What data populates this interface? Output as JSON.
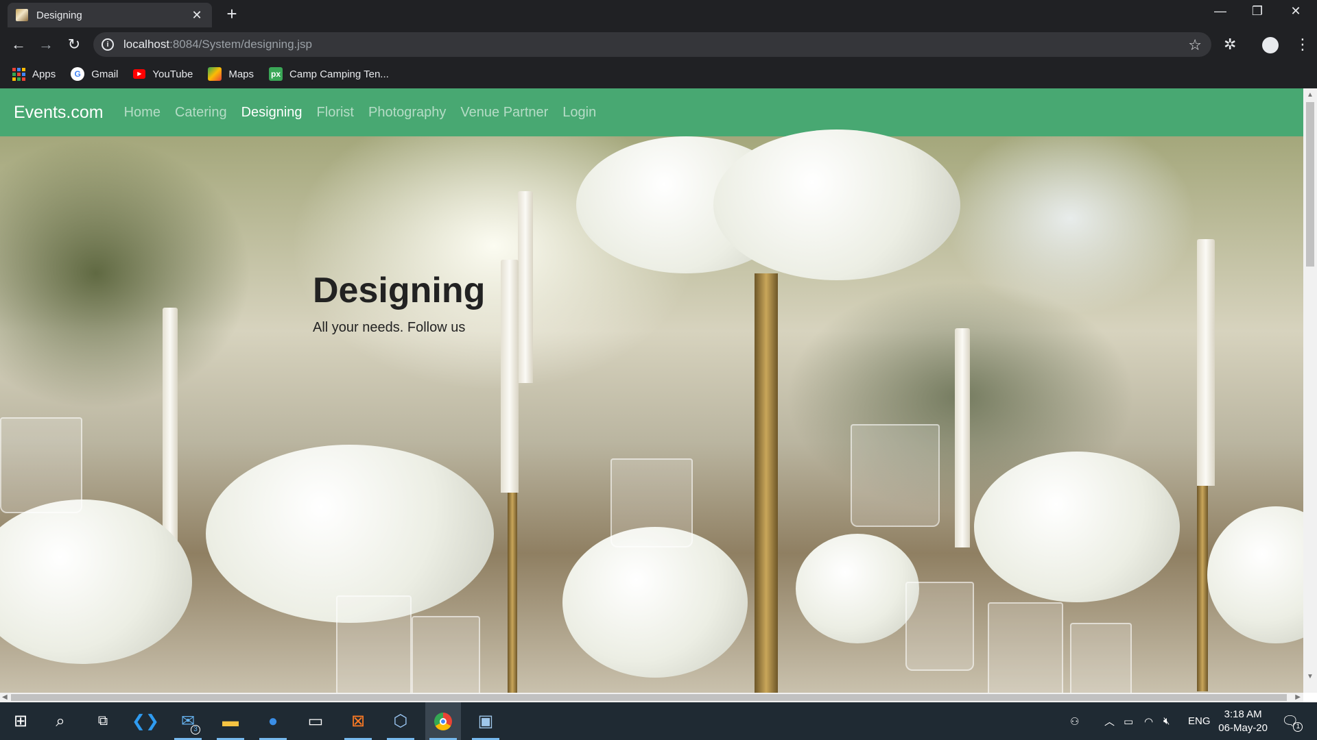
{
  "browser": {
    "tab": {
      "title": "Designing",
      "close_label": "✕"
    },
    "new_tab_label": "+",
    "window_controls": {
      "minimize": "—",
      "restore": "❐",
      "close": "✕"
    },
    "nav": {
      "back": "←",
      "forward": "→",
      "reload": "↻"
    },
    "url": {
      "host": "localhost",
      "path": ":8084/System/designing.jsp"
    },
    "bookmarks": [
      {
        "label": "Apps",
        "icon": "apps-grid-icon"
      },
      {
        "label": "Gmail",
        "icon": "google-icon"
      },
      {
        "label": "YouTube",
        "icon": "youtube-icon"
      },
      {
        "label": "Maps",
        "icon": "maps-icon"
      },
      {
        "label": "Camp Camping Ten...",
        "icon": "px-icon"
      }
    ]
  },
  "site": {
    "brand": "Events.com",
    "nav": [
      {
        "label": "Home",
        "active": false
      },
      {
        "label": "Catering",
        "active": false
      },
      {
        "label": "Designing",
        "active": true
      },
      {
        "label": "Florist",
        "active": false
      },
      {
        "label": "Photography",
        "active": false
      },
      {
        "label": "Venue Partner",
        "active": false
      },
      {
        "label": "Login",
        "active": false
      }
    ],
    "hero": {
      "title": "Designing",
      "subtitle": "All your needs. Follow us"
    },
    "colors": {
      "navbar": "#48a872"
    }
  },
  "taskbar": {
    "mail_badge": "3",
    "language": "ENG",
    "time": "3:18 AM",
    "date": "06-May-20",
    "notifications_badge": "1"
  }
}
